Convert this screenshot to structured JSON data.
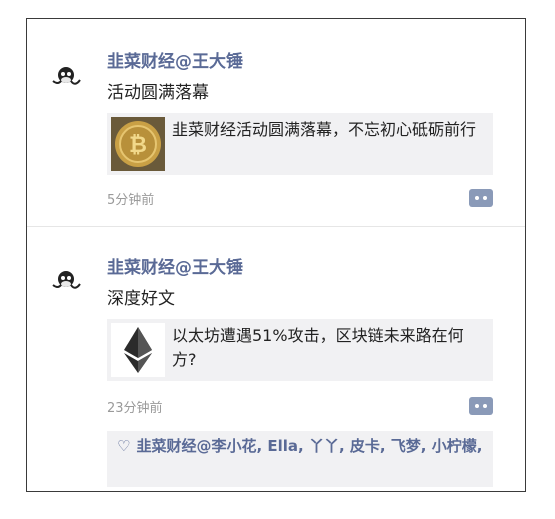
{
  "posts": [
    {
      "author": "韭菜财经@王大锤",
      "content": "活动圆满落幕",
      "card": {
        "title": "韭菜财经活动圆满落幕，不忘初心砥砺前行",
        "thumbnail_icon": "bitcoin-coin-icon"
      },
      "time": "5分钟前"
    },
    {
      "author": "韭菜财经@王大锤",
      "content": "深度好文",
      "card": {
        "title": "以太坊遭遇51%攻击，区块链未来路在何方?",
        "thumbnail_icon": "ethereum-logo-icon"
      },
      "time": "23分钟前",
      "likes": {
        "icon": "heart-outline-icon",
        "names": "韭菜财经@李小花, Ella, 丫丫, 皮卡, 飞梦, 小柠檬,"
      }
    }
  ],
  "colors": {
    "author_link": "#5a6a96",
    "card_background": "#f1f1f3",
    "comment_button": "#8a9ab8"
  }
}
